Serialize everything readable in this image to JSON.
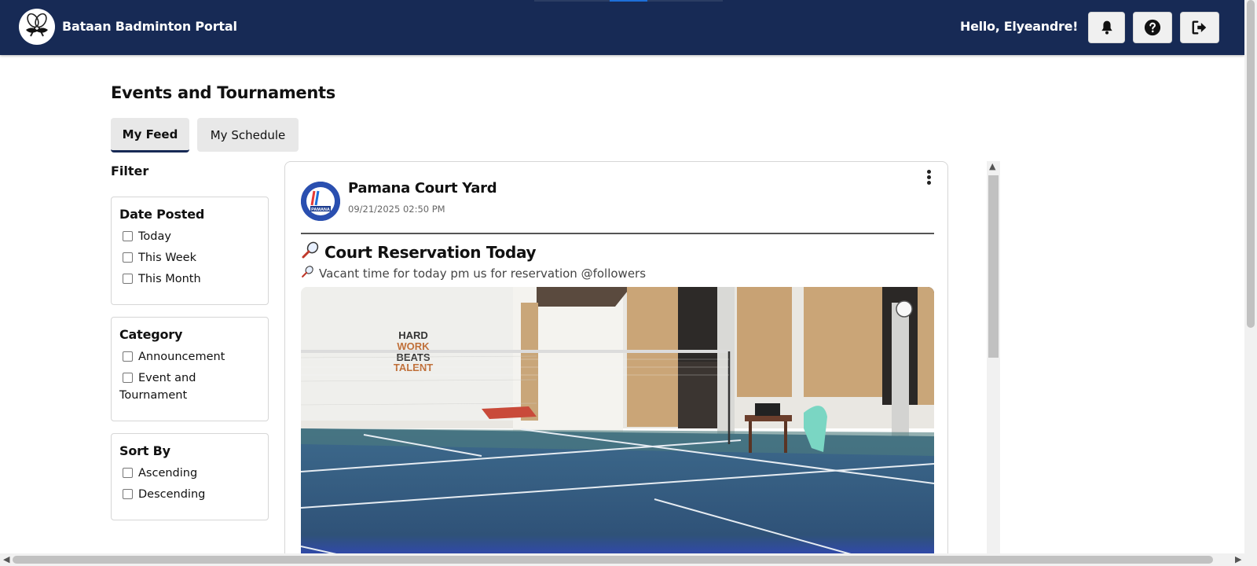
{
  "header": {
    "brand": "Bataan Badminton Portal",
    "greeting": "Hello, Elyeandre!",
    "buttons": {
      "notifications": "bell-icon",
      "help": "question-circle-icon",
      "logout": "sign-out-icon"
    },
    "colors": {
      "navbar": "#172a55",
      "accent": "#1e6fd9"
    }
  },
  "main": {
    "title": "Events and Tournaments",
    "tabs": [
      {
        "label": "My Feed",
        "active": true
      },
      {
        "label": "My Schedule",
        "active": false
      }
    ]
  },
  "filters": {
    "heading": "Filter",
    "groups": [
      {
        "title": "Date Posted",
        "options": [
          "Today",
          "This Week",
          "This Month"
        ]
      },
      {
        "title": "Category",
        "options": [
          "Announcement",
          "Event and Tournament"
        ]
      },
      {
        "title": "Sort By",
        "options": [
          "Ascending",
          "Descending"
        ]
      }
    ]
  },
  "post": {
    "author": "Pamana Court Yard",
    "timestamp": "09/21/2025 02:50 PM",
    "title": "Court Reservation Today",
    "body": "Vacant time for today pm us for reservation @followers",
    "title_icon": "badminton-racket-icon",
    "image_text": [
      "HARD",
      "WORK",
      "BEATS",
      "TALENT"
    ],
    "avatar_text": "PAMANA"
  }
}
